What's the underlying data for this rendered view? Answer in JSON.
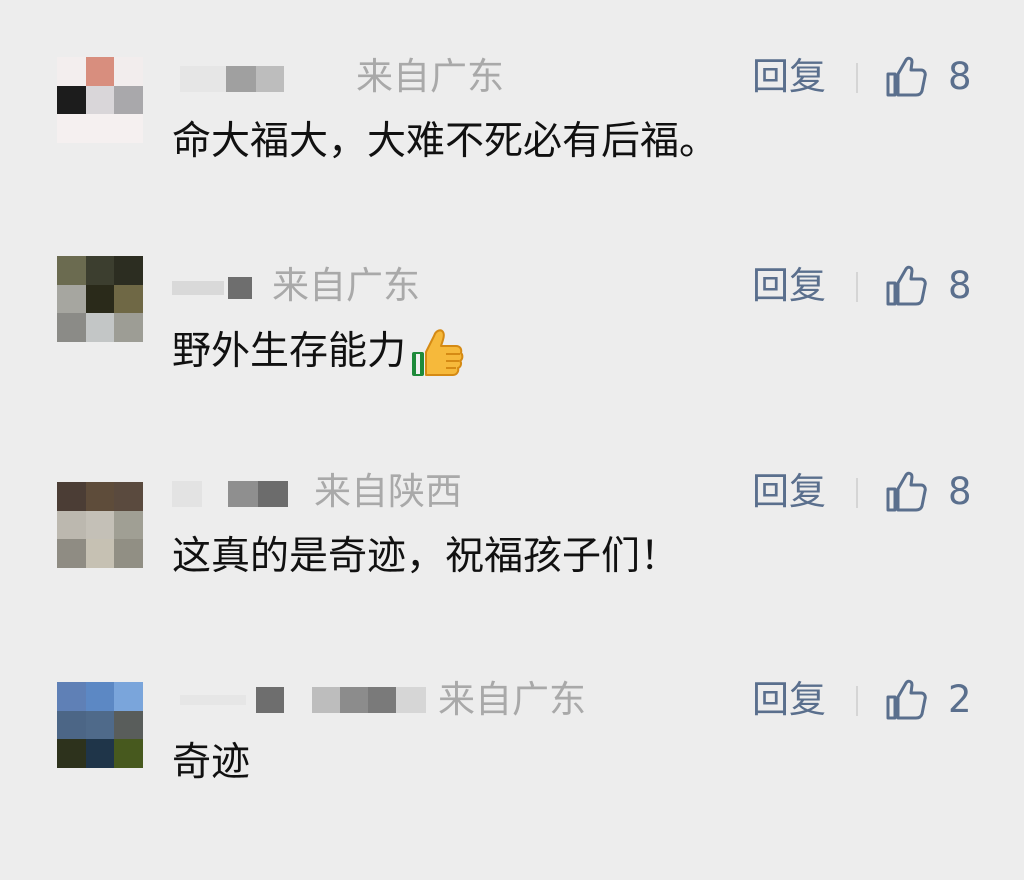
{
  "comments": [
    {
      "location": "来自广东",
      "reply_label": "回复",
      "like_count": "8",
      "text": "命大福大，大难不死必有后福。",
      "avatar_colors": [
        "#f3eeee",
        "#d88e7e",
        "#f2eded",
        "#1c1c1c",
        "#d9d6d9",
        "#a9a8ab",
        "#f5f0f0",
        "#f5f0f0",
        "#f5f0f0"
      ],
      "name_colors": [
        "#e6e6e6",
        "#a0a0a0",
        "#bdbdbd"
      ]
    },
    {
      "location": "来自广东",
      "reply_label": "回复",
      "like_count": "8",
      "text": "野外生存能力",
      "emoji": "thumbs-up-emoji",
      "avatar_colors": [
        "#6b6b50",
        "#3c3e2f",
        "#2c2d21",
        "#a6a6a0",
        "#2a2a1a",
        "#6f6845",
        "#8b8b87",
        "#c3c6c6",
        "#9d9d95"
      ],
      "name_colors": [
        "#d9d9d9",
        "#6e6e6e"
      ]
    },
    {
      "location": "来自陕西",
      "reply_label": "回复",
      "like_count": "8",
      "text": "这真的是奇迹，祝福孩子们！",
      "avatar_colors": [
        "#4b3d35",
        "#5e4c3a",
        "#5a4a3e",
        "#bcb8af",
        "#c4c0b7",
        "#a09f94",
        "#8f8c83",
        "#c6c1b3",
        "#918f84"
      ],
      "name_colors": [
        "#e3e3e3",
        "#8f8f8f",
        "#6c6c6c"
      ]
    },
    {
      "location": "来自广东",
      "reply_label": "回复",
      "like_count": "2",
      "text": "奇迹",
      "avatar_colors": [
        "#5f80b6",
        "#5c88c4",
        "#7aa5db",
        "#4c6686",
        "#4f6a8a",
        "#595d5b",
        "#2d321c",
        "#1f3549",
        "#47591e"
      ],
      "name_colors": [
        "#e6e6e6",
        "#6e6e6e",
        "#bdbdbd",
        "#8c8c8c",
        "#7a7a7a",
        "#d6d6d6"
      ]
    }
  ]
}
